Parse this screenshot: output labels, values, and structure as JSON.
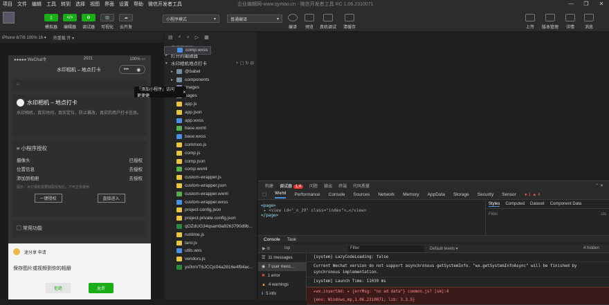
{
  "menubar": {
    "items": [
      "项目",
      "文件",
      "编辑",
      "工具",
      "转到",
      "选择",
      "视图",
      "界面",
      "设置",
      "帮助",
      "微信开发者工具"
    ],
    "title": "企业编辑网-www.qymao.cn - 微信开发者工具 RC 1.06.2310071"
  },
  "window_controls": [
    "—",
    "❐",
    "✕"
  ],
  "toolbar": {
    "left_buttons": [
      {
        "label": "模拟器",
        "icon": "phone-icon",
        "active": true
      },
      {
        "label": "编辑器",
        "icon": "code-icon",
        "active": true
      },
      {
        "label": "调试器",
        "icon": "debug-icon",
        "active": true
      },
      {
        "label": "可视化",
        "icon": "visual-icon",
        "active": false
      },
      {
        "label": "云开发",
        "icon": "cloud-icon",
        "active": false
      }
    ],
    "mode_select": "小程序模式",
    "compile_select": "普通编译",
    "mid_buttons": [
      {
        "label": "编译",
        "icon": "refresh-icon"
      },
      {
        "label": "预览",
        "icon": "eye-icon"
      },
      {
        "label": "真机调试",
        "icon": "device-icon"
      },
      {
        "label": "清缓存",
        "icon": "clear-icon"
      }
    ],
    "right_buttons": [
      {
        "label": "上传",
        "icon": "upload-icon"
      },
      {
        "label": "版本管理",
        "icon": "branch-icon"
      },
      {
        "label": "详情",
        "icon": "info-icon"
      },
      {
        "label": "消息",
        "icon": "bell-icon"
      }
    ]
  },
  "simulator": {
    "device": "iPhone 6/7/8 100% 16 ▾",
    "hotreload": "热重载 开 ▾",
    "status_left": "●●●●● WeChat令",
    "status_time": "2021",
    "status_right": "100% ▭",
    "nav_title": "水印相机 – 地点打卡",
    "tip_text": "「添加小程序」访问更便捷",
    "tip_close": "✕",
    "card1": {
      "title": "水印相机 – 地点打卡",
      "desc": "水印相机，真实时间，真实定位，防止篡改，真实的用户打卡信息。"
    },
    "auth_section": {
      "title": "小程序授权",
      "rows": [
        {
          "label": "摄像头",
          "value": "已授权"
        },
        {
          "label": "位置信息",
          "value": "去授权"
        },
        {
          "label": "添加到相册",
          "value": "去授权"
        }
      ],
      "hint": "提示：水印相机需要获取授权后，才可正常使用",
      "btn_auth": "一键授权",
      "btn_enter": "直接进入"
    },
    "more": "常用功能",
    "sheet": {
      "app": "迷分享 申请",
      "body": "保存图片或视频到你的相册",
      "reject": "拒绝",
      "allow": "允许"
    }
  },
  "explorer": {
    "title": "资源管理器",
    "open_editors": "打开的编辑器",
    "project": "水印相机地点打卡",
    "files": [
      {
        "name": "@babel",
        "type": "folder",
        "expandable": true
      },
      {
        "name": "components",
        "type": "folder",
        "expandable": true
      },
      {
        "name": "images",
        "type": "folder",
        "expandable": true
      },
      {
        "name": "pages",
        "type": "folder",
        "expandable": true
      },
      {
        "name": "app.js",
        "type": "js"
      },
      {
        "name": "app.json",
        "type": "json"
      },
      {
        "name": "app.wxss",
        "type": "wxss"
      },
      {
        "name": "base.wxml",
        "type": "wxml"
      },
      {
        "name": "base.wxss",
        "type": "wxss"
      },
      {
        "name": "common.js",
        "type": "js"
      },
      {
        "name": "comp.js",
        "type": "js"
      },
      {
        "name": "comp.json",
        "type": "json"
      },
      {
        "name": "comp.wxml",
        "type": "wxml"
      },
      {
        "name": "comp.wxss",
        "type": "wxss",
        "selected": true
      },
      {
        "name": "custom-wrapper.js",
        "type": "js"
      },
      {
        "name": "custom-wrapper.json",
        "type": "json"
      },
      {
        "name": "custom-wrapper.wxml",
        "type": "wxml"
      },
      {
        "name": "custom-wrapper.wxss",
        "type": "wxss"
      },
      {
        "name": "project.config.json",
        "type": "json"
      },
      {
        "name": "project.private.config.json",
        "type": "json"
      },
      {
        "name": "qOZdUG34qsam9a9263790d9b...",
        "type": "other"
      },
      {
        "name": "runtime.js",
        "type": "js"
      },
      {
        "name": "taro.js",
        "type": "js"
      },
      {
        "name": "utils.wxs",
        "type": "wxs"
      },
      {
        "name": "vendors.js",
        "type": "js"
      },
      {
        "name": "ys0mVT6JCCjc04a2816e4f94ac...",
        "type": "other"
      }
    ]
  },
  "devtools": {
    "top_tabs": [
      "构建",
      "调试器",
      "问题",
      "输出",
      "终端",
      "代码质量"
    ],
    "top_badge": "1,4",
    "tabs": [
      "Wxml",
      "Performance",
      "Console",
      "Sources",
      "Network",
      "Memory",
      "AppData",
      "Storage",
      "Security",
      "Sensor"
    ],
    "badges": "● 1  ▲ 4",
    "elements": [
      "<page>",
      "▸ <view id=\"_n_29\" class=\"index\">…</view>",
      "</page>"
    ],
    "styles_tabs": [
      "Styles",
      "Computed",
      "Dataset",
      "Component Data"
    ],
    "styles_filter": "Filter",
    "styles_cls": ".cls",
    "console_tabs": [
      "Console",
      "Task"
    ],
    "context": "top",
    "filter": "Filter",
    "levels": "Default levels ▾",
    "hidden": "4 hidden",
    "sidebar": [
      {
        "label": "11 messages",
        "icon": "list-icon"
      },
      {
        "label": "7 user mess...",
        "icon": "user-icon",
        "active": true
      },
      {
        "label": "1 error",
        "icon": "error-icon"
      },
      {
        "label": "4 warnings",
        "icon": "warning-icon"
      },
      {
        "label": "5 info",
        "icon": "info-icon"
      }
    ],
    "logs": [
      {
        "text": "[system] LazyCodeLoading: false",
        "type": "normal"
      },
      {
        "text": "Current Wechat version do not support asynchronous getSystemInfo. \"wx.getSystemInfoAsync\" will be finished by synchronous implementation.",
        "type": "normal"
      },
      {
        "text": "[system] Launch Time: 11039 ms",
        "type": "normal"
      },
      {
        "text": "▸wx.insertAd: ▸ {errMsg: \"no ad data\"}                    common.js? [sm]:4",
        "type": "err"
      },
      {
        "text": "{env: Windows,mp,1.06.2310071; lib: 3.3.5}",
        "type": "err"
      }
    ]
  }
}
